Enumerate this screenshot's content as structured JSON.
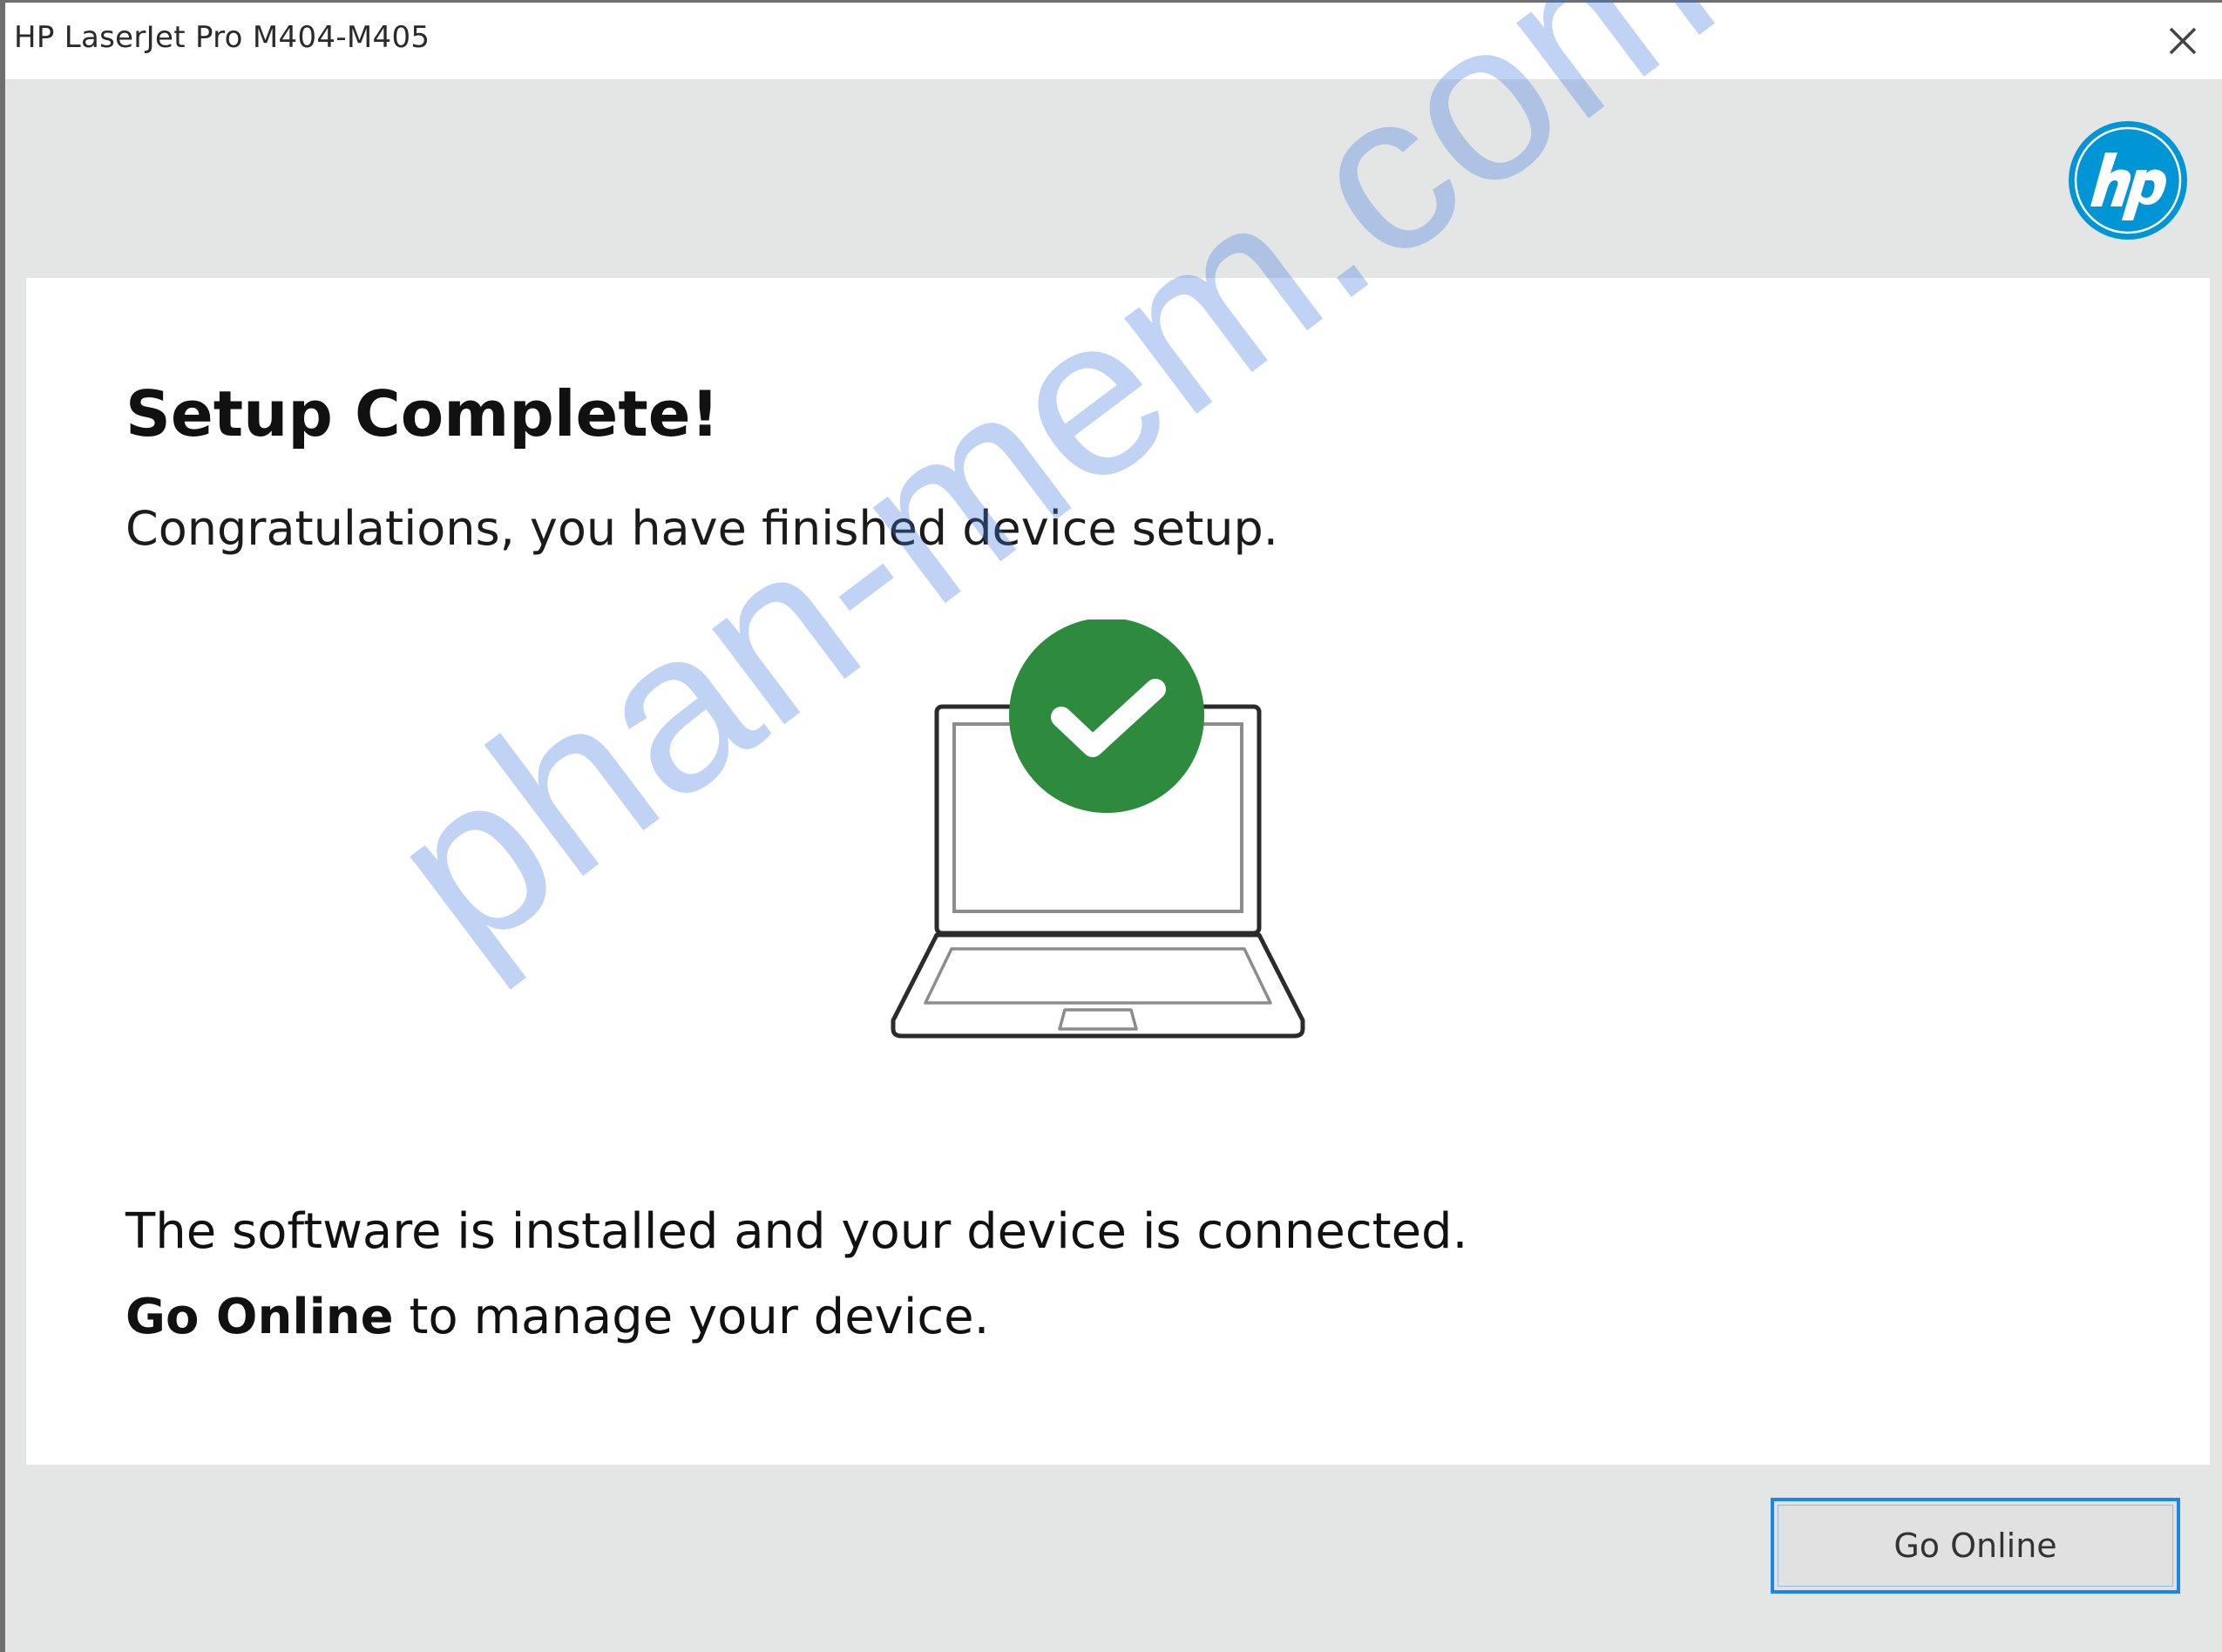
{
  "window": {
    "title": "HP LaserJet Pro M404-M405",
    "close_icon": "close-icon"
  },
  "header": {
    "logo_icon": "hp-logo-icon",
    "logo_color": "#0096d6"
  },
  "content": {
    "heading": "Setup Complete!",
    "subtitle": "Congratulations, you have finished device setup.",
    "illustration": {
      "icon": "laptop-icon",
      "badge_icon": "checkmark-icon",
      "badge_color": "#2e8b3e"
    },
    "status_line": "The software is installed and your device is connected.",
    "cta_strong": "Go Online",
    "cta_rest": " to manage your device."
  },
  "footer": {
    "go_online_label": "Go Online",
    "button_border_color": "#1a86e6"
  },
  "watermark": {
    "text": "phan-mem.com"
  }
}
